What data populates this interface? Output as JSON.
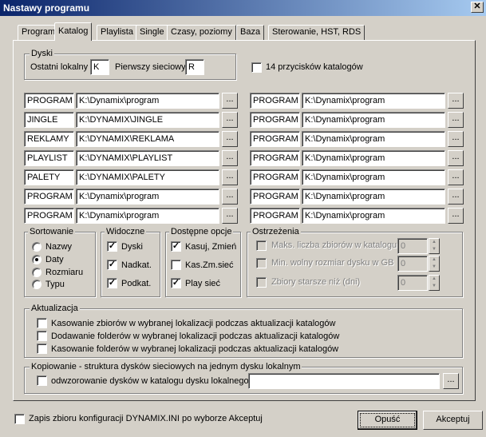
{
  "window": {
    "title": "Nastawy programu",
    "close": "✕"
  },
  "tabs": [
    "Program",
    "Katalog",
    "Playlista",
    "Single",
    "Czasy, poziomy",
    "Baza",
    "Sterowanie, HST, RDS"
  ],
  "dyski": {
    "title": "Dyski",
    "local_label": "Ostatni lokalny",
    "local_value": "K",
    "net_label": "Pierwszy sieciowy",
    "net_value": "R"
  },
  "buttons14": {
    "label": "14 przycisków katalogów",
    "checked": false
  },
  "browse_label": "...",
  "left_rows": [
    {
      "name": "PROGRAM",
      "path": "K:\\Dynamix\\program"
    },
    {
      "name": "JINGLE",
      "path": "K:\\DYNAMIX\\JINGLE"
    },
    {
      "name": "REKLAMY",
      "path": "K:\\DYNAMIX\\REKLAMA"
    },
    {
      "name": "PLAYLIST",
      "path": "K:\\DYNAMIX\\PLAYLIST"
    },
    {
      "name": "PALETY",
      "path": "K:\\DYNAMIX\\PALETY"
    },
    {
      "name": "PROGRAM",
      "path": "K:\\Dynamix\\program"
    },
    {
      "name": "PROGRAM",
      "path": "K:\\Dynamix\\program"
    }
  ],
  "right_rows": [
    {
      "name": "PROGRAM",
      "path": "K:\\Dynamix\\program"
    },
    {
      "name": "PROGRAM",
      "path": "K:\\Dynamix\\program"
    },
    {
      "name": "PROGRAM",
      "path": "K:\\Dynamix\\program"
    },
    {
      "name": "PROGRAM",
      "path": "K:\\Dynamix\\program"
    },
    {
      "name": "PROGRAM",
      "path": "K:\\Dynamix\\program"
    },
    {
      "name": "PROGRAM",
      "path": "K:\\Dynamix\\program"
    },
    {
      "name": "PROGRAM",
      "path": "K:\\Dynamix\\program"
    }
  ],
  "sortowanie": {
    "title": "Sortowanie",
    "options": [
      "Nazwy",
      "Daty",
      "Rozmiaru",
      "Typu"
    ],
    "selected": "Daty"
  },
  "widoczne": {
    "title": "Widoczne",
    "items": [
      {
        "label": "Dyski",
        "checked": true
      },
      {
        "label": "Nadkat.",
        "checked": true
      },
      {
        "label": "Podkat.",
        "checked": true
      }
    ]
  },
  "dostepne": {
    "title": "Dostępne opcje",
    "items": [
      {
        "label": "Kasuj, Zmień",
        "checked": true
      },
      {
        "label": "Kas.Zm.sieć",
        "checked": false
      },
      {
        "label": "Play sieć",
        "checked": true
      }
    ]
  },
  "ostrzezenia": {
    "title": "Ostrzeżenia",
    "items": [
      {
        "label": "Maks. liczba zbiorów w katalogu",
        "value": "0"
      },
      {
        "label": "Min. wolny rozmiar dysku w GB",
        "value": "0"
      },
      {
        "label": "Zbiory starsze niż (dni)",
        "value": "0"
      }
    ]
  },
  "aktualizacja": {
    "title": "Aktualizacja",
    "items": [
      "Kasowanie zbiorów w wybranej lokalizacji podczas aktualizacji katalogów",
      "Dodawanie folderów w wybranej lokalizacji podczas aktualizacji katalogów",
      "Kasowanie folderów w wybranej lokalizacji podczas aktualizacji katalogów"
    ]
  },
  "kopiowanie": {
    "title": "Kopiowanie - struktura dysków sieciowych na jednym dysku lokalnym",
    "label": "odwzorowanie dysków w katalogu dysku lokalnego:",
    "value": ""
  },
  "footer": {
    "save_label": "Zapis zbioru konfiguracji DYNAMIX.INI po wyborze Akceptuj",
    "cancel": "Opuść",
    "accept": "Akceptuj"
  }
}
